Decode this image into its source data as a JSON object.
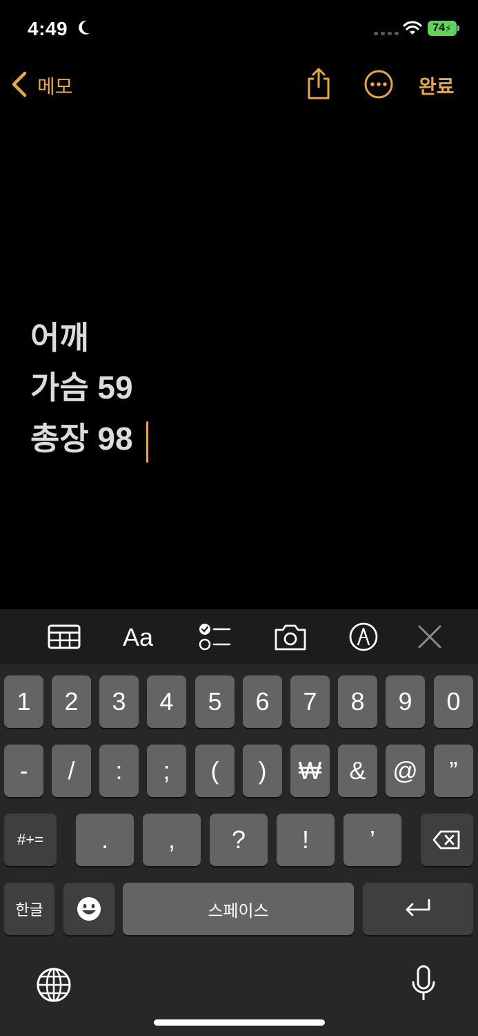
{
  "status_bar": {
    "time": "4:49",
    "battery": "74"
  },
  "nav": {
    "back_label": "메모",
    "done_label": "완료"
  },
  "note": {
    "lines": [
      "어깨",
      "가슴 59",
      "총장 98"
    ]
  },
  "keyboard": {
    "row1": [
      "1",
      "2",
      "3",
      "4",
      "5",
      "6",
      "7",
      "8",
      "9",
      "0"
    ],
    "row2": [
      "-",
      "/",
      ":",
      ";",
      "(",
      ")",
      "₩",
      "&",
      "@",
      "”"
    ],
    "row3": [
      ".",
      ",",
      "?",
      "!",
      "’"
    ],
    "symbols_label": "#+=",
    "lang_label": "한글",
    "space_label": "스페이스"
  },
  "colors": {
    "accent": "#e8a83c",
    "battery": "#5fd35a",
    "key": "#646464",
    "key_dark": "#3f3f3f"
  }
}
